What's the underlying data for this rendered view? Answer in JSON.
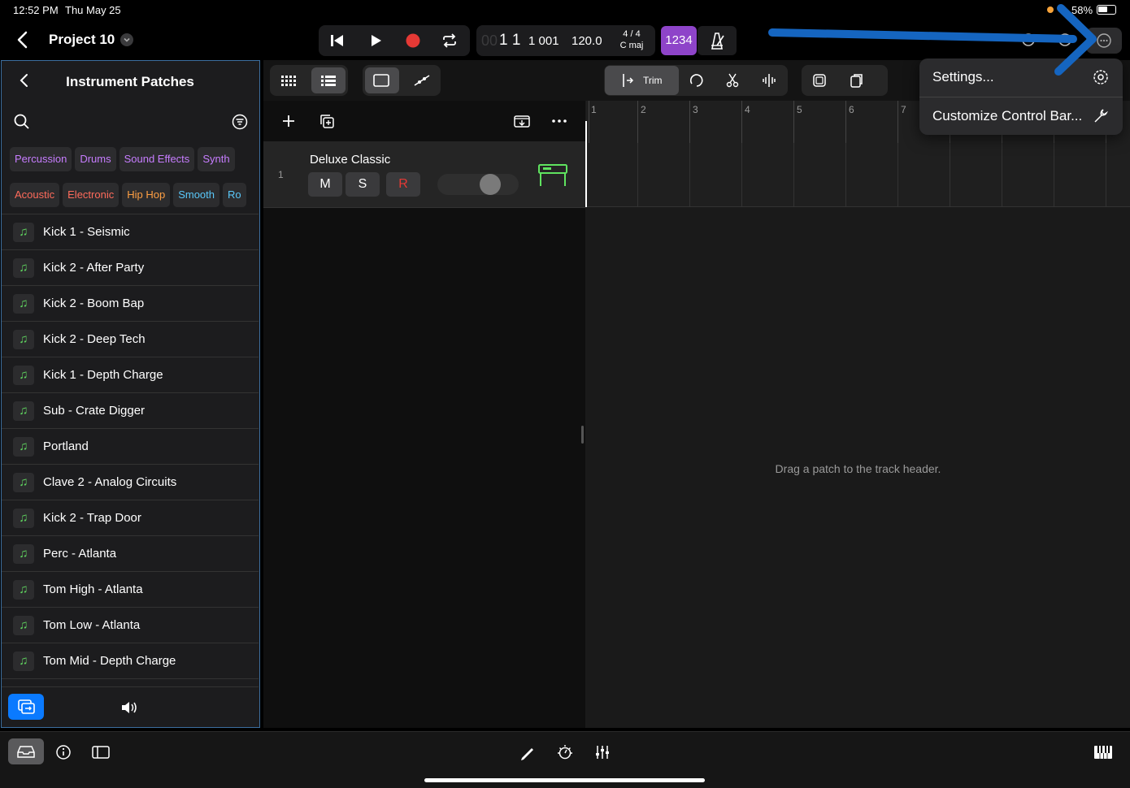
{
  "status": {
    "time": "12:52 PM",
    "date": "Thu May 25",
    "battery": "58%"
  },
  "header": {
    "title": "Project 10"
  },
  "lcd": {
    "position_dim": "00",
    "position": "1 1",
    "ticks": "1 001",
    "tempo": "120.0",
    "time_sig": "4 / 4",
    "key": "C maj",
    "count_in": "1234"
  },
  "browser": {
    "title": "Instrument Patches",
    "tags_row1": [
      "Percussion",
      "Drums",
      "Sound Effects",
      "Synth"
    ],
    "tags_row2": [
      "Acoustic",
      "Electronic",
      "Hip Hop",
      "Smooth",
      "Ro"
    ],
    "tag_colors": {
      "purple": "#c77dff",
      "red": "#ff6b5b",
      "orange": "#ff9f43",
      "blue": "#5ac8fa"
    },
    "patches": [
      "Kick 1 - Seismic",
      "Kick 2 - After Party",
      "Kick 2 - Boom Bap",
      "Kick 2 - Deep Tech",
      "Kick 1 - Depth Charge",
      "Sub - Crate Digger",
      "Portland",
      "Clave 2 - Analog Circuits",
      "Kick 2 - Trap Door",
      "Perc - Atlanta",
      "Tom High - Atlanta",
      "Tom Low - Atlanta",
      "Tom Mid - Depth Charge"
    ]
  },
  "toolbar": {
    "trim_label": "Trim"
  },
  "track": {
    "number": "1",
    "name": "Deluxe Classic",
    "mute": "M",
    "solo": "S",
    "record": "R"
  },
  "ruler": {
    "bars": [
      "1",
      "2",
      "3",
      "4",
      "5",
      "6",
      "7"
    ]
  },
  "empty_hint": "Drag a patch to the track header.",
  "menu": {
    "settings": "Settings...",
    "customize": "Customize Control Bar..."
  },
  "colors": {
    "accent": "#0a7aff",
    "annotation": "#1565c0",
    "track_icon": "#5fe35f",
    "record": "#e53935"
  }
}
